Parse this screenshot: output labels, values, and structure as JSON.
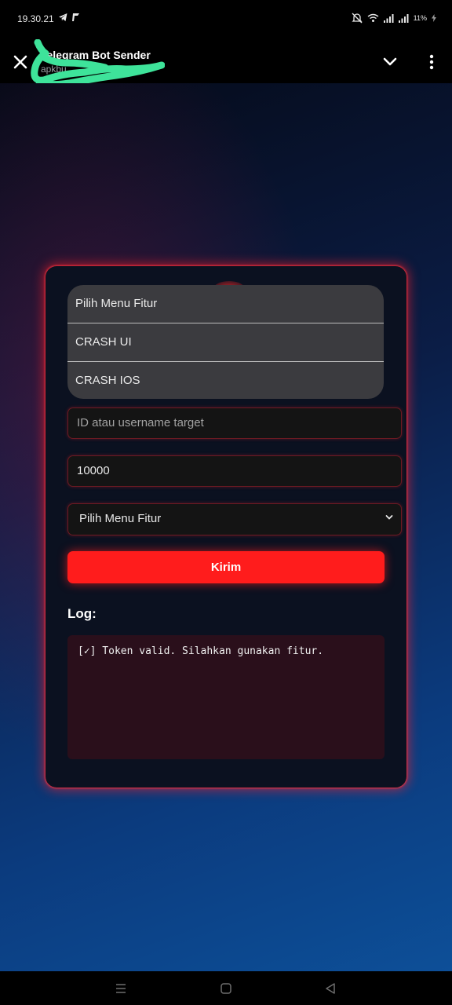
{
  "status": {
    "time": "19.30.21",
    "battery": "11%"
  },
  "app_bar": {
    "title": "Telegram Bot Sender",
    "subtitle": "apkbu"
  },
  "form": {
    "dropdown_options": [
      "Pilih Menu Fitur",
      "CRASH UI",
      "CRASH IOS"
    ],
    "target_placeholder": "ID atau username target",
    "amount_value": "10000",
    "feature_select_value": "Pilih Menu Fitur",
    "send_label": "Kirim"
  },
  "log": {
    "title": "Log:",
    "lines": [
      "[✓] Token valid. Silahkan gunakan fitur."
    ]
  },
  "colors": {
    "accent": "#ff1c1c",
    "card_background": "#0b1120",
    "scribble": "#3ee39a"
  }
}
